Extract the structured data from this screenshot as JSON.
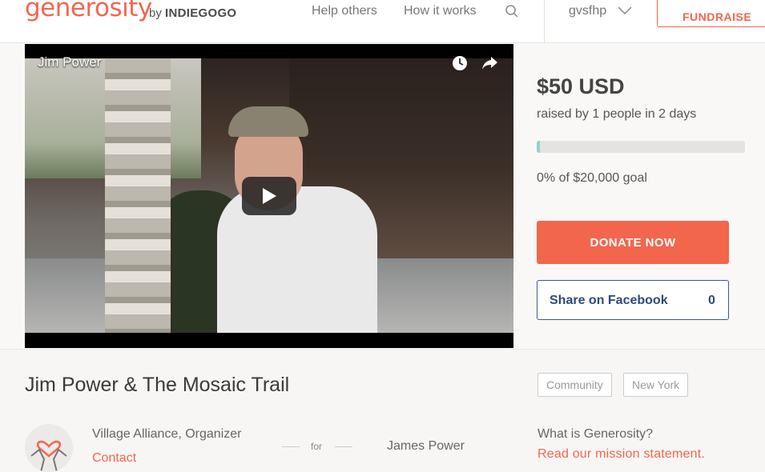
{
  "header": {
    "logo": "generosity",
    "byline_prefix": "by",
    "byline_brand": "INDIEGOGO",
    "nav": [
      {
        "label": "Help others"
      },
      {
        "label": "How it works"
      }
    ],
    "username": "gvsfhp",
    "fundraise_label": "FUNDRAISE"
  },
  "video": {
    "title": "Jim Power"
  },
  "sidebar": {
    "raised": "$50 USD",
    "raised_sub": "raised by 1 people in 2 days",
    "progress_fraction": 0.0025,
    "goal": "0% of $20,000 goal",
    "donate_label": "DONATE NOW",
    "facebook_label": "Share on Facebook",
    "facebook_count": "0"
  },
  "campaign": {
    "title": "Jim Power & The Mosaic Trail",
    "tags": [
      "Community",
      "New York"
    ],
    "organizer": "Village Alliance, Organizer",
    "contact_label": "Contact",
    "for_label": "for",
    "beneficiary": "James Power",
    "what_label": "What is Generosity?",
    "mission_label": "Read our mission statement."
  },
  "colors": {
    "brand": "#f2664e",
    "progress": "#8ed1cf",
    "facebook": "#3b5a8a"
  }
}
